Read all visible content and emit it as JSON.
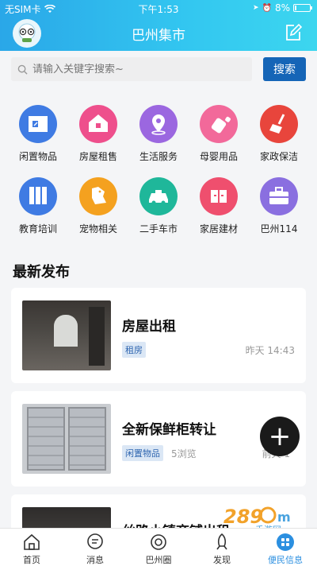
{
  "status_bar": {
    "carrier": "无SIM卡",
    "time": "下午1:53",
    "battery": "8%"
  },
  "header": {
    "title": "巴州集市"
  },
  "search": {
    "placeholder": "请输入关键字搜索~",
    "button": "搜索"
  },
  "categories": [
    {
      "label": "闲置物品",
      "icon": "store-icon",
      "color": "#3f7be3"
    },
    {
      "label": "房屋租售",
      "icon": "house-icon",
      "color": "#ee4f8c"
    },
    {
      "label": "生活服务",
      "icon": "location-pin-icon",
      "color": "#9b67e0"
    },
    {
      "label": "母婴用品",
      "icon": "baby-bottle-icon",
      "color": "#f2699a"
    },
    {
      "label": "家政保洁",
      "icon": "broom-icon",
      "color": "#e8453c"
    },
    {
      "label": "教育培训",
      "icon": "books-icon",
      "color": "#3f7be3"
    },
    {
      "label": "宠物相关",
      "icon": "dog-icon",
      "color": "#f4a11f"
    },
    {
      "label": "二手车市",
      "icon": "car-icon",
      "color": "#1fb79a"
    },
    {
      "label": "家居建材",
      "icon": "furniture-icon",
      "color": "#ef4f6e"
    },
    {
      "label": "巴州114",
      "icon": "briefcase-icon",
      "color": "#8a6fe0"
    }
  ],
  "section": {
    "title": "最新发布"
  },
  "posts": [
    {
      "title": "房屋出租",
      "tag": "租房",
      "views": "",
      "time": "昨天 14:43"
    },
    {
      "title": "全新保鲜柜转让",
      "tag": "闲置物品",
      "views": "5浏览",
      "time": "前天 1"
    },
    {
      "title": "丝路小镇商铺出租",
      "tag": "",
      "views": "",
      "time": ""
    }
  ],
  "fab": {
    "label": "+"
  },
  "watermark": {
    "text": "289手游网"
  },
  "tabs": [
    {
      "label": "首页",
      "icon": "home-icon",
      "active": false
    },
    {
      "label": "消息",
      "icon": "message-icon",
      "active": false
    },
    {
      "label": "巴州圈",
      "icon": "circle-icon",
      "active": false
    },
    {
      "label": "发现",
      "icon": "rocket-icon",
      "active": false
    },
    {
      "label": "便民信息",
      "icon": "grid-icon",
      "active": true
    }
  ]
}
